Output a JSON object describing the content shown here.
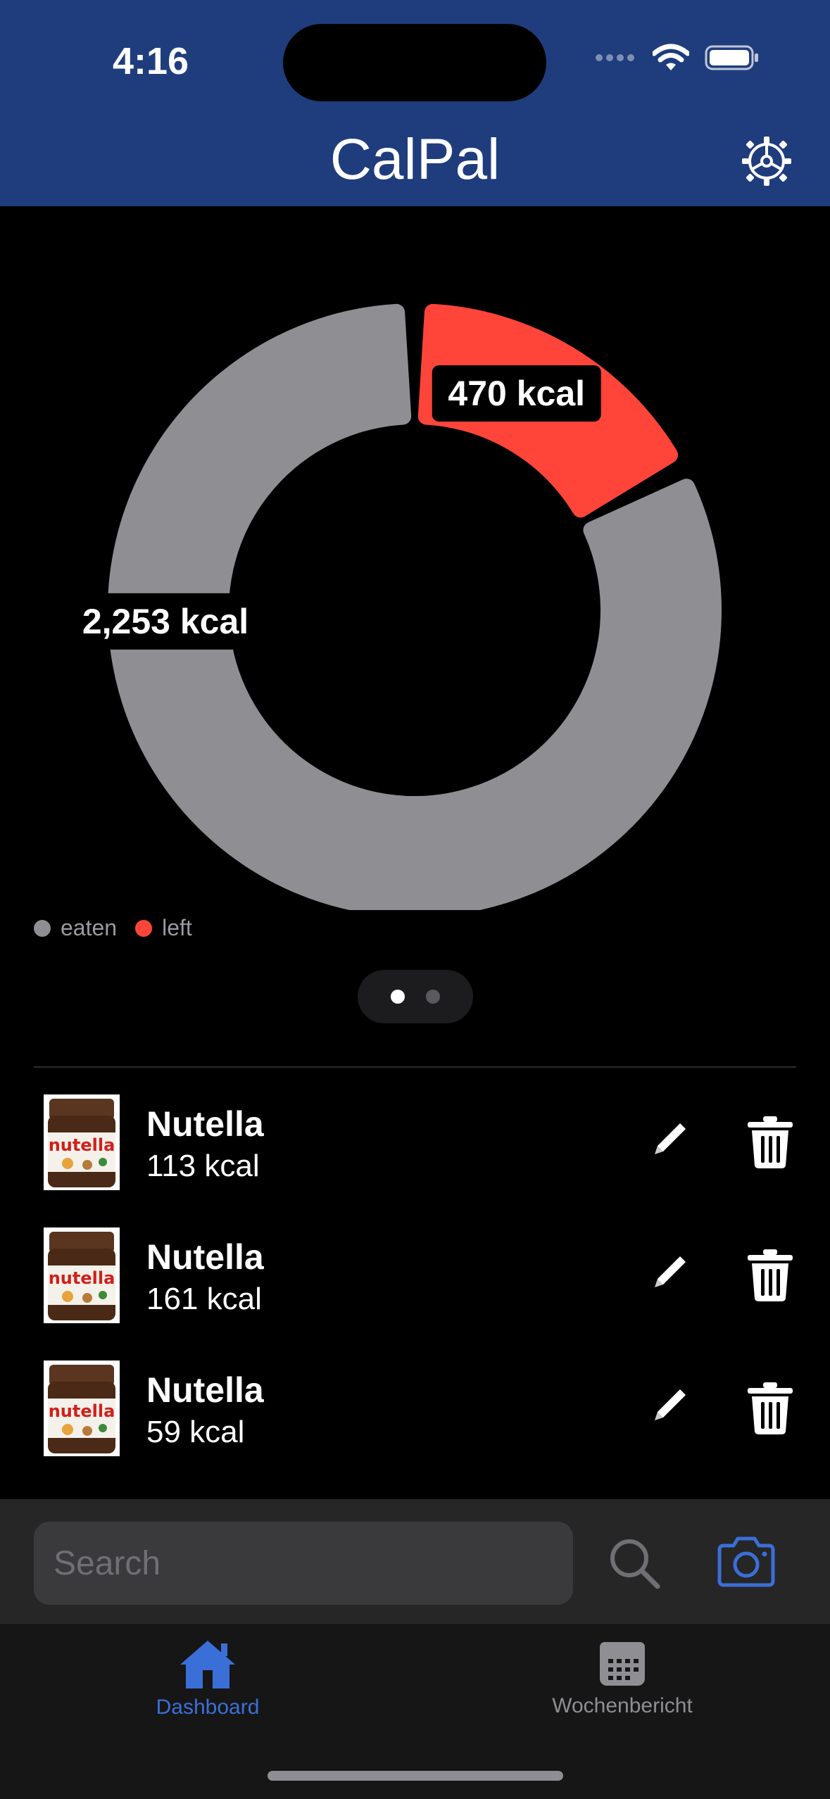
{
  "status_bar": {
    "time": "4:16"
  },
  "header": {
    "title": "CalPal",
    "settings_icon": "gear-icon"
  },
  "chart_data": {
    "type": "pie",
    "subtype": "donut",
    "slices": [
      {
        "name": "eaten",
        "value": 2253,
        "label": "2,253 kcal",
        "color": "#8e8e93"
      },
      {
        "name": "left",
        "value": 470,
        "label": "470 kcal",
        "color": "#ff453a"
      }
    ],
    "legend": [
      "eaten",
      "left"
    ],
    "legend_placement": "bottom-left"
  },
  "pager": {
    "pages": 2,
    "active": 0
  },
  "food_items": [
    {
      "name": "Nutella",
      "kcal": "113 kcal",
      "image_label": "nutella"
    },
    {
      "name": "Nutella",
      "kcal": "161 kcal",
      "image_label": "nutella"
    },
    {
      "name": "Nutella",
      "kcal": "59 kcal",
      "image_label": "nutella"
    }
  ],
  "search": {
    "placeholder": "Search",
    "value": ""
  },
  "tabs": [
    {
      "label": "Dashboard",
      "icon": "house-icon",
      "active": true
    },
    {
      "label": "Wochenbericht",
      "icon": "calendar-icon",
      "active": false
    }
  ],
  "colors": {
    "header": "#1f3d7d",
    "accent": "#3b6fd8",
    "eaten": "#8e8e93",
    "left": "#ff453a"
  }
}
